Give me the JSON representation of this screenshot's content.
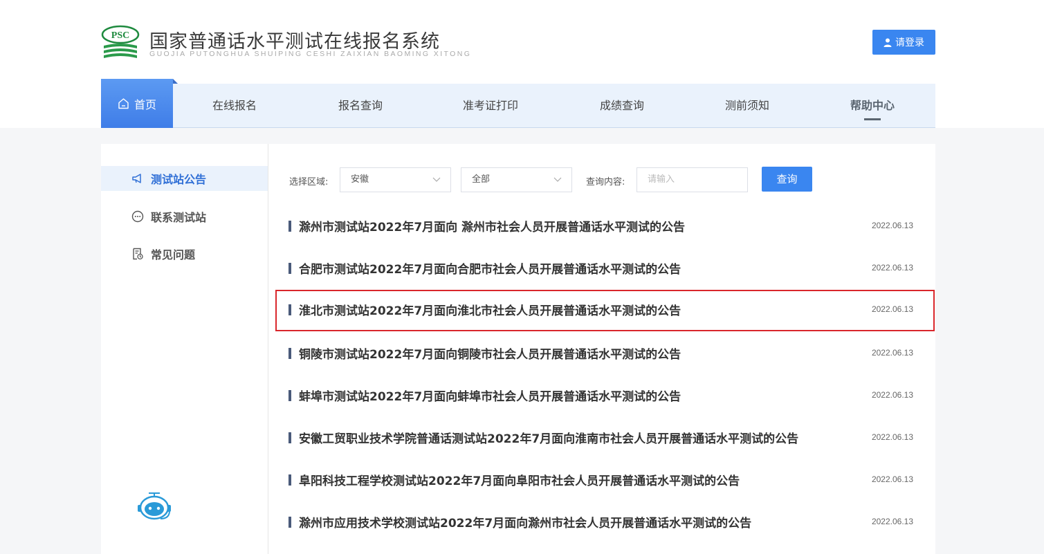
{
  "header": {
    "logo_mark_text": "PSC",
    "title": "国家普通话水平测试在线报名系统",
    "subtitle": "GUOJIA PUTONGHUA SHUIPING CESHI ZAIXIAN BAOMING XITONG",
    "login_label": "请登录"
  },
  "nav": {
    "home_label": "首页",
    "items": [
      "在线报名",
      "报名查询",
      "准考证打印",
      "成绩查询",
      "测前须知",
      "帮助中心"
    ],
    "active": "帮助中心"
  },
  "sidebar": {
    "items": [
      {
        "label": "测试站公告",
        "icon": "megaphone-icon",
        "active": true
      },
      {
        "label": "联系测试站",
        "icon": "chat-bubble-icon",
        "active": false
      },
      {
        "label": "常见问题",
        "icon": "faq-document-icon",
        "active": false
      }
    ]
  },
  "filters": {
    "region_label": "选择区域:",
    "province_value": "安徽",
    "city_value": "全部",
    "query_label": "查询内容:",
    "query_placeholder": "请输入",
    "search_button": "查询"
  },
  "announcements": [
    {
      "title": "滁州市测试站2022年7月面向 滁州市社会人员开展普通话水平测试的公告",
      "date": "2022.06.13"
    },
    {
      "title": "合肥市测试站2022年7月面向合肥市社会人员开展普通话水平测试的公告",
      "date": "2022.06.13"
    },
    {
      "title": "淮北市测试站2022年7月面向淮北市社会人员开展普通话水平测试的公告",
      "date": "2022.06.13",
      "highlighted": true
    },
    {
      "title": "铜陵市测试站2022年7月面向铜陵市社会人员开展普通话水平测试的公告",
      "date": "2022.06.13"
    },
    {
      "title": "蚌埠市测试站2022年7月面向蚌埠市社会人员开展普通话水平测试的公告",
      "date": "2022.06.13"
    },
    {
      "title": "安徽工贸职业技术学院普通话测试站2022年7月面向淮南市社会人员开展普通话水平测试的公告",
      "date": "2022.06.13"
    },
    {
      "title": "阜阳科技工程学校测试站2022年7月面向阜阳市社会人员开展普通话水平测试的公告",
      "date": "2022.06.13"
    },
    {
      "title": "滁州市应用技术学校测试站2022年7月面向滁州市社会人员开展普通话水平测试的公告",
      "date": "2022.06.13"
    }
  ],
  "colors": {
    "accent": "#3a86f0",
    "highlight_border": "#d9262b",
    "nav_bg": "#eaf2fc"
  }
}
